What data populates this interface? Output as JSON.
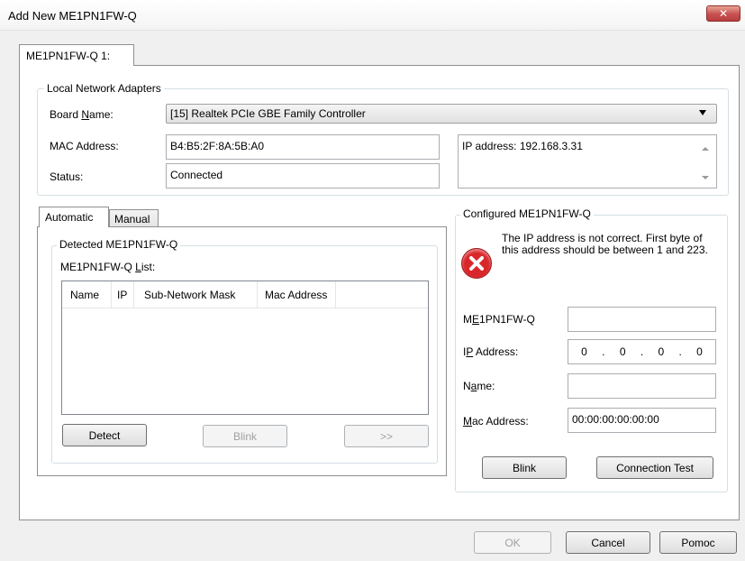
{
  "window": {
    "title": "Add New ME1PN1FW-Q",
    "close_label": "✕"
  },
  "outer_tab": {
    "label": "ME1PN1FW-Q 1:"
  },
  "local_adapters": {
    "legend": "Local Network Adapters",
    "board_name_label": "Board Name:",
    "board_name_value": "[15] Realtek PCIe GBE Family Controller",
    "mac_label": "MAC Address:",
    "mac_value": "B4:B5:2F:8A:5B:A0",
    "status_label": "Status:",
    "status_value": "Connected",
    "ip_label": "IP address:",
    "ip_value": "192.168.3.31"
  },
  "inner_tabs": [
    {
      "label": "Automatic"
    },
    {
      "label": "Manual"
    }
  ],
  "detected": {
    "legend": "Detected ME1PN1FW-Q",
    "list_label": "ME1PN1FW-Q List:",
    "columns": [
      "Name",
      "IP",
      "Sub-Network Mask",
      "Mac Address"
    ],
    "detect_button": "Detect",
    "blink_button": "Blink",
    "forward_button": ">>"
  },
  "configured": {
    "legend": "Configured ME1PN1FW-Q",
    "error_message": "The IP address is not correct. First byte of this address should be between 1 and 223.",
    "device_label": "ME1PN1FW-Q",
    "device_value": "",
    "ip_label": "IP Address:",
    "ip_octets": [
      "0",
      "0",
      "0",
      "0"
    ],
    "ip_separator": ".",
    "name_label": "Name:",
    "name_value": "",
    "mac_label": "Mac Address:",
    "mac_value": "00:00:00:00:00:00",
    "blink_button": "Blink",
    "connection_test_button": "Connection Test"
  },
  "footer": {
    "ok_button": "OK",
    "cancel_button": "Cancel",
    "help_button": "Pomoc"
  },
  "colors": {
    "error_red": "#d9262a",
    "close_red": "#c75050"
  }
}
